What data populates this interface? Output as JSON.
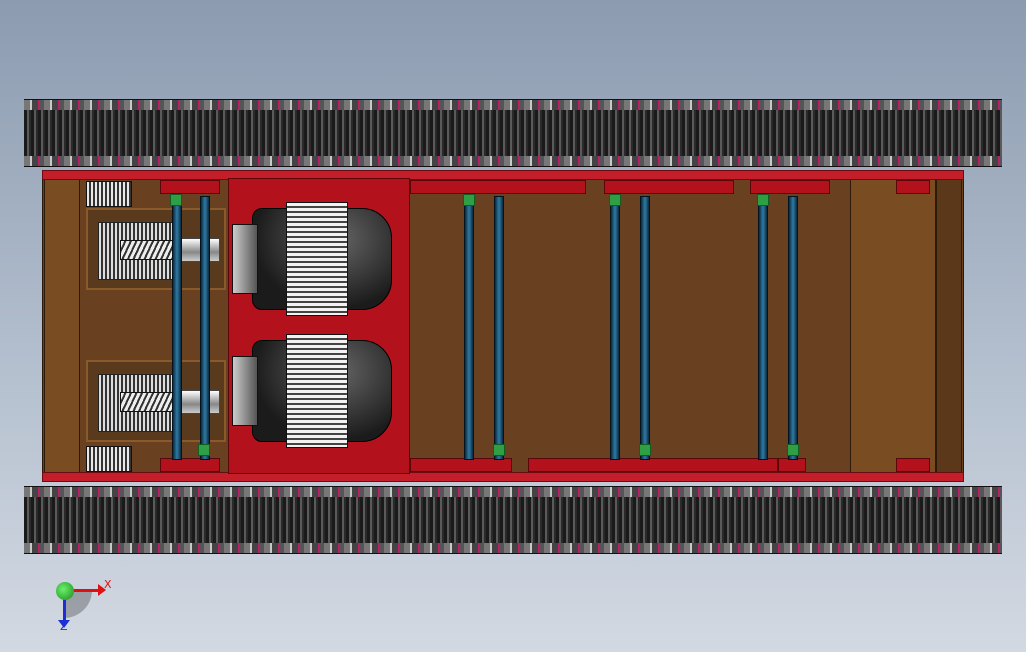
{
  "view": {
    "triad": {
      "x_label": "X",
      "z_label": "Z"
    }
  },
  "colors": {
    "frame": "#c41e2a",
    "chassis": "#6a4120",
    "axle": "#2f7aa3",
    "bushing": "#2ea043",
    "track": "#1a1a1a"
  }
}
